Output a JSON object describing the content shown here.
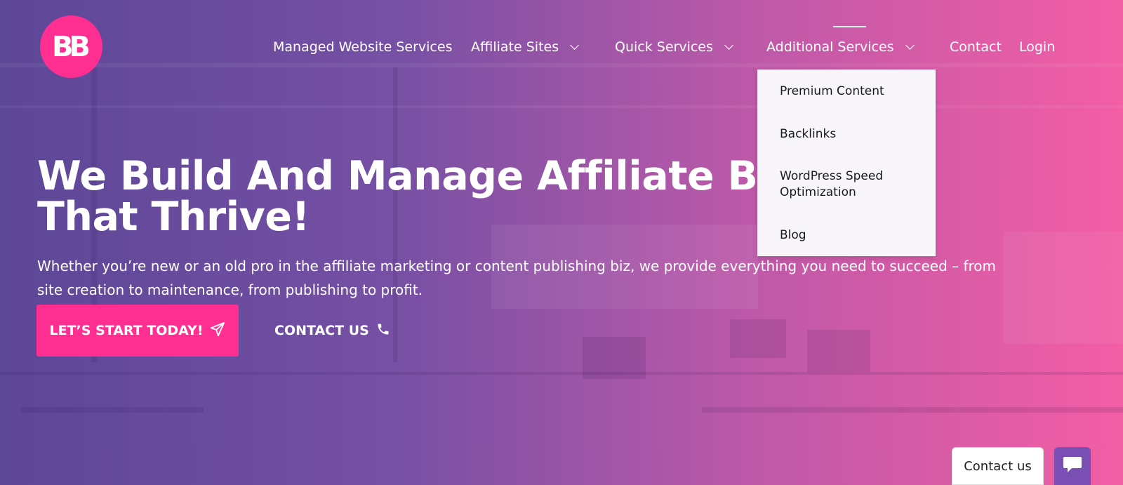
{
  "logo": {
    "text": "BB"
  },
  "nav": {
    "items": [
      {
        "label": "Managed Website Services",
        "has_dropdown": false
      },
      {
        "label": "Affiliate Sites",
        "has_dropdown": true
      },
      {
        "label": "Quick Services",
        "has_dropdown": true
      },
      {
        "label": "Additional Services",
        "has_dropdown": true,
        "active": true
      },
      {
        "label": "Contact",
        "has_dropdown": false
      },
      {
        "label": "Login",
        "has_dropdown": false
      }
    ]
  },
  "dropdown": {
    "items": [
      "Premium Content",
      "Backlinks",
      "WordPress Speed Optimization",
      "Blog"
    ]
  },
  "hero": {
    "headline_line1": "We Build And Manage Affiliate Brands",
    "headline_line2": "That Thrive!",
    "subtext": "Whether you’re new or an old pro in the affiliate marketing or content publishing biz, we provide everything you need to succeed – from site creation to maintenance, from publishing to profit.",
    "cta_label": "LET’S START TODAY!",
    "contact_label": "CONTACT US"
  },
  "chat": {
    "label": "Contact us"
  },
  "colors": {
    "brand_pink": "#ff2f92",
    "chat_purple": "#7a4fb3",
    "dropdown_bg": "#f8f6fb"
  }
}
